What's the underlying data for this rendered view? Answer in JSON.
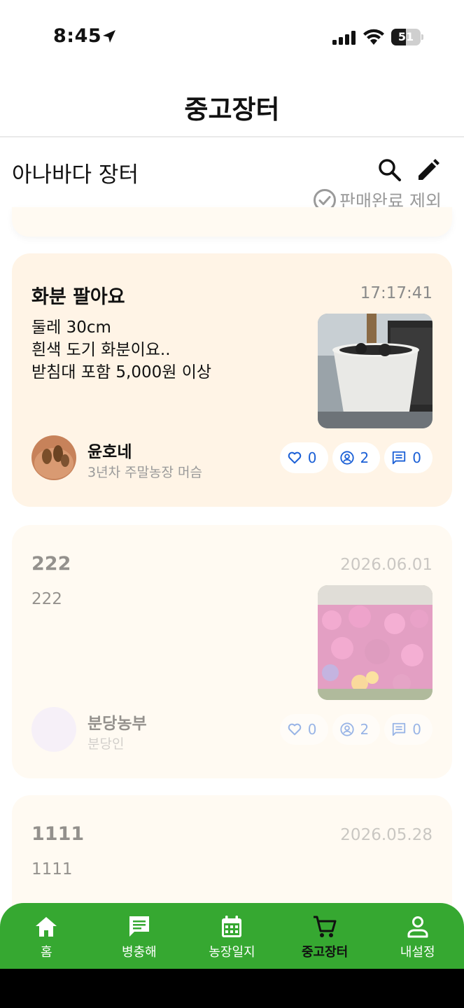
{
  "status_bar": {
    "time": "8:45",
    "battery": "51",
    "battery_level": 0.51
  },
  "header": {
    "title": "중고장터"
  },
  "section": {
    "title": "아나바다 장터",
    "exclude_sold_label": "판매완료 제외",
    "search_icon": "search-icon",
    "edit_icon": "pencil-icon"
  },
  "posts": [
    {
      "title": "화분 팔아요",
      "time": "17:17:41",
      "body": [
        "둘레 30cm",
        "흰색 도기 화분이요..",
        "받침대 포함 5,000원 이상"
      ],
      "author": {
        "name": "윤호네",
        "desc": "3년차 주말농장 머슴"
      },
      "likes": "0",
      "views": "2",
      "comments": "0",
      "image": "white pot with plant"
    },
    {
      "title": "222",
      "time": "2026.06.01",
      "body": [
        "222"
      ],
      "author": {
        "name": "분당농부",
        "desc": "분당인"
      },
      "likes": "0",
      "views": "2",
      "comments": "0",
      "image": "pink flower field"
    },
    {
      "title": "1111",
      "time": "2026.05.28",
      "body": [
        "1111"
      ]
    }
  ],
  "tabs": [
    {
      "label": "홈",
      "icon": "home-icon"
    },
    {
      "label": "병충해",
      "icon": "chat-icon"
    },
    {
      "label": "농장일지",
      "icon": "calendar-icon"
    },
    {
      "label": "중고장터",
      "icon": "cart-icon",
      "active": true
    },
    {
      "label": "내설정",
      "icon": "person-icon"
    }
  ],
  "colors": {
    "accent": "#36a831",
    "card_bg": "#fff4e6",
    "stat_blue": "#1a5fd6"
  }
}
